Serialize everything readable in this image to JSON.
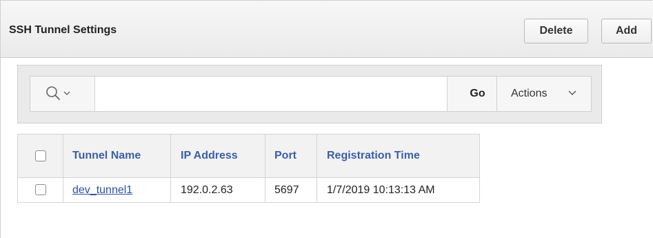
{
  "region": {
    "title": "SSH Tunnel Settings",
    "delete_label": "Delete",
    "add_label": "Add"
  },
  "toolbar": {
    "search_icon": "search-icon",
    "search_value": "",
    "go_label": "Go",
    "actions_label": "Actions"
  },
  "report": {
    "columns": [
      "Tunnel Name",
      "IP Address",
      "Port",
      "Registration Time"
    ],
    "rows": [
      {
        "tunnel_name": "dev_tunnel1",
        "ip_address": "192.0.2.63",
        "port": "5697",
        "registration_time": "1/7/2019 10:13:13 AM"
      }
    ]
  },
  "colors": {
    "link": "#2f4fa0",
    "header_text": "#3b5ea8",
    "region_header_bg": "#eaeaea"
  }
}
